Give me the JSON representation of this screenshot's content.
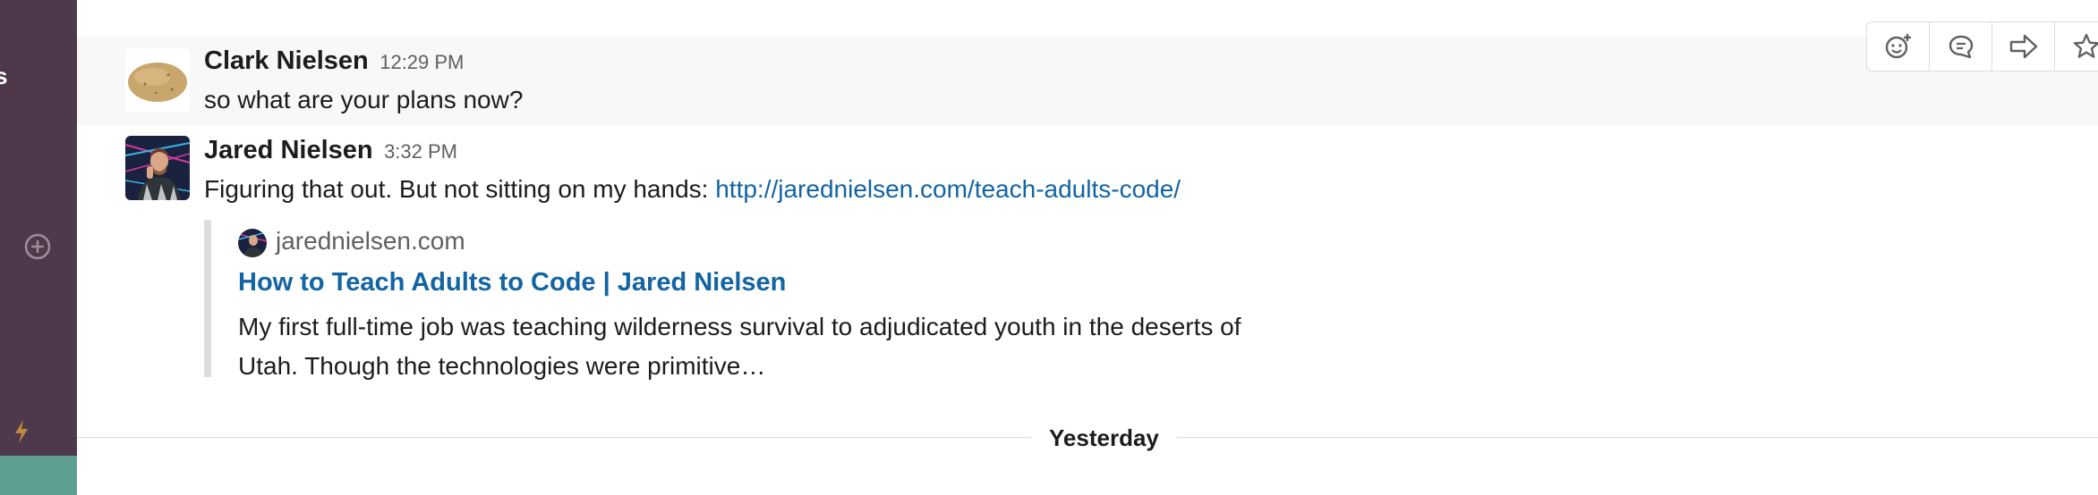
{
  "sidebar": {
    "edge_glyph": "s",
    "icons": [
      "add-icon",
      "bolt-icon"
    ]
  },
  "messages": [
    {
      "author": "Clark Nielsen",
      "time": "12:29 PM",
      "text": "so what are your plans now?",
      "avatar": "potato-avatar"
    },
    {
      "author": "Jared Nielsen",
      "time": "3:32 PM",
      "text": "Figuring that out. But not sitting on my hands: ",
      "link": "http://jarednielsen.com/teach-adults-code/",
      "avatar": "jared-avatar",
      "attachment": {
        "site": "jarednielsen.com",
        "title": "How to Teach Adults to Code | Jared Nielsen",
        "description": "My first full-time job was teaching wilderness survival to adjudicated youth in the deserts of Utah. Though the technologies were primitive…"
      }
    }
  ],
  "toolbar": {
    "actions": [
      "add-reaction-icon",
      "start-thread-icon",
      "share-message-icon",
      "star-icon",
      "more-actions-icon"
    ]
  },
  "divider": {
    "label": "Yesterday"
  },
  "colors": {
    "sidebar": "#4d394b",
    "sidebar_footer": "#5e9e91",
    "link": "#1264a3",
    "hover_row": "#f8f8f8"
  }
}
